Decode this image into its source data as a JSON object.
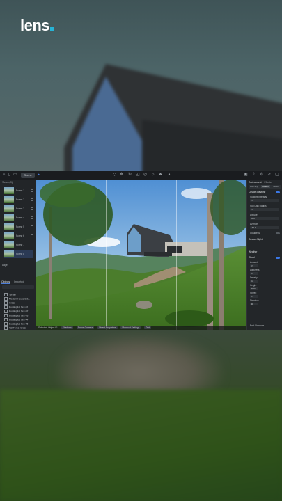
{
  "brand": {
    "logo_text": "lens"
  },
  "colors": {
    "accent": "#27b4d6",
    "toolbar_bg": "#1a1c1f",
    "panel_bg": "#232629",
    "selection": "#3b78e7"
  },
  "toolbar": {
    "mode_pill": "Scene",
    "left_icons": [
      "menu-icon",
      "file-icon",
      "folder-icon",
      "scene-icon",
      "play-icon"
    ],
    "center_icons": [
      "select-icon",
      "move-icon",
      "rotate-icon",
      "scale-icon",
      "camera-icon",
      "light-icon",
      "paint-icon",
      "tree-icon",
      "terrain-icon",
      "measure-icon"
    ],
    "right_icons": [
      "render-icon",
      "export-icon",
      "settings-icon",
      "share-icon",
      "window-icon"
    ]
  },
  "left_panel": {
    "header": "Views (9)",
    "scenes": [
      {
        "label": "Scene 1"
      },
      {
        "label": "Scene 2"
      },
      {
        "label": "Scene 3"
      },
      {
        "label": "Scene 4"
      },
      {
        "label": "Scene 5"
      },
      {
        "label": "Scene 6"
      },
      {
        "label": "Scene 7"
      },
      {
        "label": "Scene 8"
      }
    ],
    "footer_label": "Layer",
    "tabs": [
      "Objects",
      "Imported"
    ],
    "objects": [
      "Terrain",
      "Modern House Ext...",
      "Grass",
      "Eucalyptus tree 01",
      "Eucalyptus tree 02",
      "Eucalyptus tree 03",
      "Eucalyptus tree 04",
      "Eucalyptus tree 05",
      "Tall Forest Grass"
    ]
  },
  "viewport": {
    "status_items": [
      "Selected: Object 01",
      "Shadows",
      "Scene Camera",
      "Object Properties",
      "Viewport Settings",
      "Grid"
    ]
  },
  "right_panel": {
    "tabs": [
      "Environment",
      "Effects"
    ],
    "subtabs": [
      "Day/Sky",
      "Custom",
      "HDRI"
    ],
    "section_sky": "Custom Daytime",
    "fields": [
      {
        "label": "Sunlight Intensity",
        "value": "1.0"
      },
      {
        "label": "Sun Disk Radius",
        "value": "1.0"
      },
      {
        "label": "Altitude",
        "value": "35.0"
      },
      {
        "label": "Azimuth",
        "value": "140.0"
      }
    ],
    "toggles": [
      "Cloudless",
      "Ground"
    ],
    "section_custom": "Custom Night",
    "section_weather": "Weather",
    "section_cloud": "Cloud",
    "cloud_fields": [
      {
        "label": "Amount",
        "value": "0.5"
      },
      {
        "label": "Darkness",
        "value": "0.2"
      },
      {
        "label": "Density",
        "value": "0.8"
      },
      {
        "label": "Height",
        "value": "2000"
      },
      {
        "label": "Speed",
        "value": "0.5"
      },
      {
        "label": "Direction",
        "value": "90"
      }
    ],
    "footer": "Fast Shadows"
  }
}
